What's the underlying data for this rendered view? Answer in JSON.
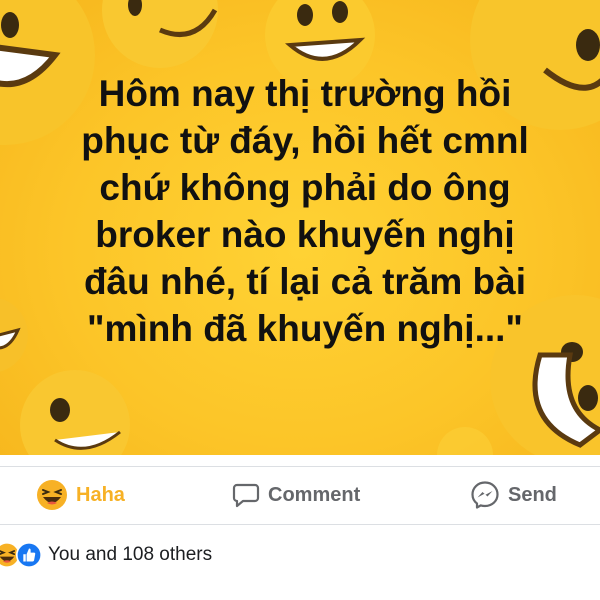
{
  "post": {
    "text_lines": [
      "Hôm nay thị trường hồi",
      "phục từ đáy, hồi hết cmnl",
      "chứ không phải do ông",
      "broker nào khuyến nghị",
      "đâu nhé, tí lại cả trăm bài",
      "\"mình đã khuyến nghị...\""
    ],
    "background_color": "#fcc528"
  },
  "actions": {
    "haha_label": "Haha",
    "comment_label": "Comment",
    "send_label": "Send",
    "haha_color": "#f7b125",
    "icon_color": "#65676b"
  },
  "reactions": {
    "icons": [
      "haha-icon",
      "like-icon"
    ],
    "summary": "You and 108 others"
  }
}
